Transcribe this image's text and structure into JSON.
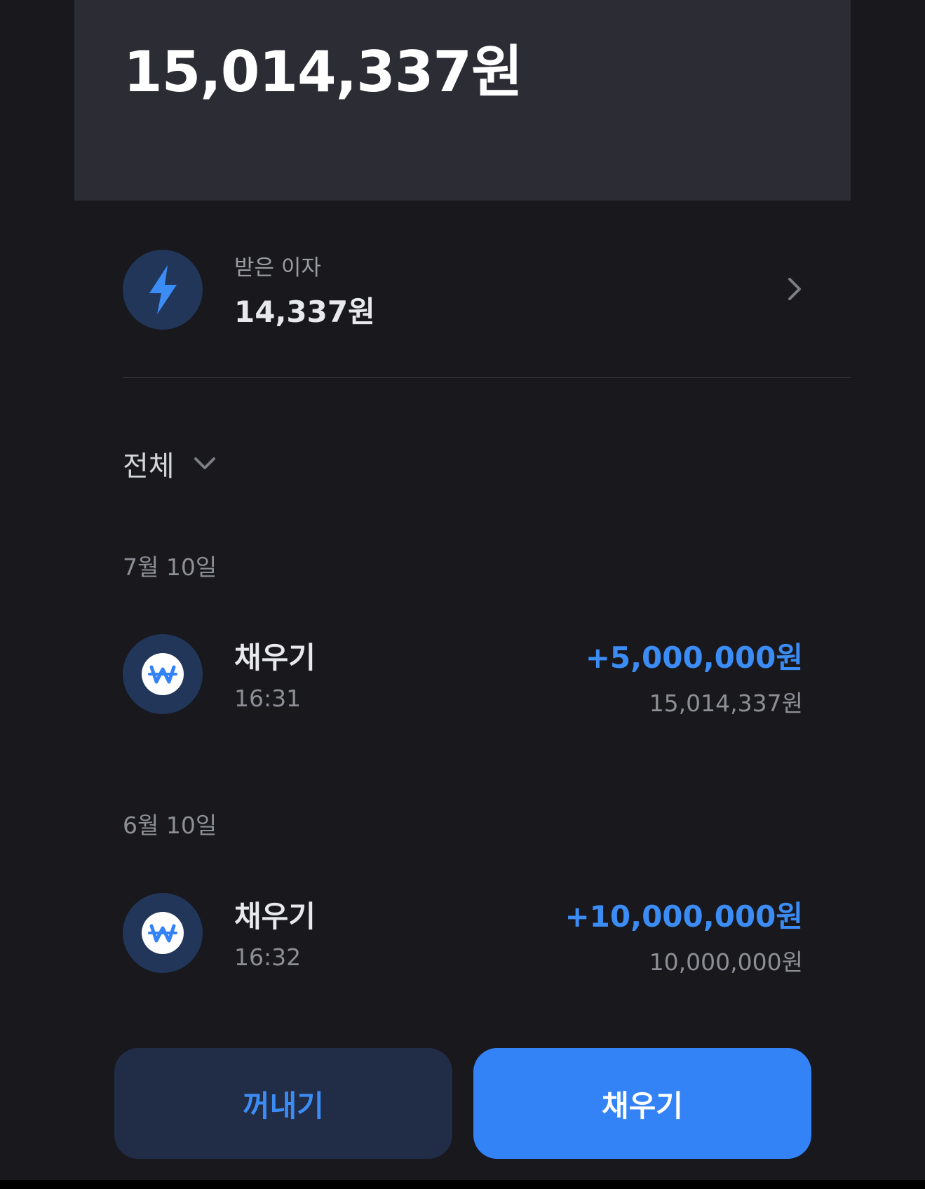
{
  "balance": {
    "amount": "15,014,337원"
  },
  "interest": {
    "label": "받은 이자",
    "value": "14,337원",
    "icon": "lightning-icon"
  },
  "filter": {
    "label": "전체"
  },
  "groups": [
    {
      "date": "7월 10일",
      "transactions": [
        {
          "title": "채우기",
          "time": "16:31",
          "amount": "+5,000,000원",
          "balance_after": "15,014,337원",
          "icon": "won-icon"
        }
      ]
    },
    {
      "date": "6월 10일",
      "transactions": [
        {
          "title": "채우기",
          "time": "16:32",
          "amount": "+10,000,000원",
          "balance_after": "10,000,000원",
          "icon": "won-icon"
        }
      ]
    }
  ],
  "actions": {
    "withdraw_label": "꺼내기",
    "deposit_label": "채우기"
  },
  "colors": {
    "background": "#18181d",
    "card": "#2c2c34",
    "accent": "#3483f6",
    "icon_circle": "#22365a"
  }
}
